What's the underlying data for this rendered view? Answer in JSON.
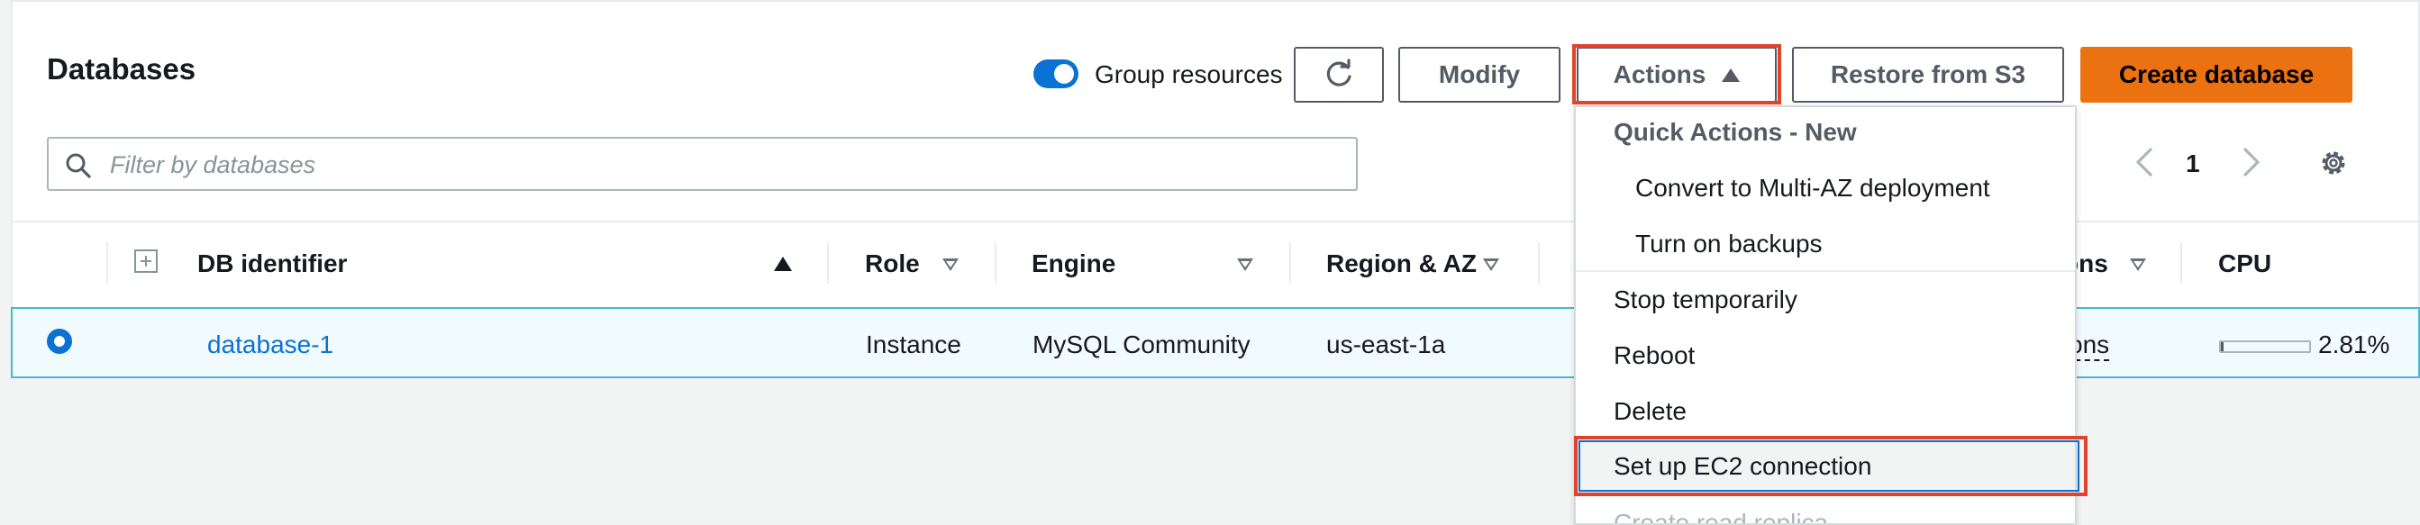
{
  "header": {
    "title": "Databases",
    "group_resources_label": "Group resources",
    "group_resources_on": true,
    "refresh_icon": "refresh-icon",
    "modify_label": "Modify",
    "actions_label": "Actions",
    "restore_label": "Restore from S3",
    "create_label": "Create database",
    "create_color": "#ec7211"
  },
  "search": {
    "placeholder": "Filter by databases"
  },
  "pagination": {
    "current_page": "1"
  },
  "table": {
    "columns": [
      "DB identifier",
      "Role",
      "Engine",
      "Region & AZ",
      "ons",
      "CPU"
    ],
    "rows": [
      {
        "db_identifier": "database-1",
        "role": "Instance",
        "engine": "MySQL Community",
        "region_az": "us-east-1a",
        "actions_partial": "tions",
        "cpu": "2.81%",
        "cpu_fraction": 0.0281
      }
    ]
  },
  "actions_menu": {
    "group_label": "Quick Actions - New",
    "quick_actions": [
      "Convert to Multi-AZ deployment",
      "Turn on backups"
    ],
    "items": [
      "Stop temporarily",
      "Reboot",
      "Delete",
      "Set up EC2 connection",
      "Create read replica"
    ],
    "highlighted_item": "Set up EC2 connection",
    "highlight_color": "#e0442e"
  }
}
